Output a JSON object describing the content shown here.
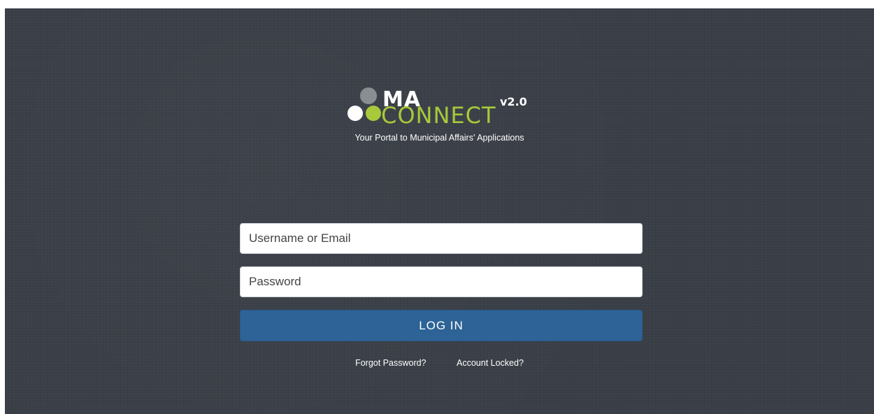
{
  "logo": {
    "brand_top": "MA",
    "brand_bottom": "CONNECT",
    "version": "v2.0",
    "colors": {
      "dot_gray": "#8a8d91",
      "dot_white": "#ffffff",
      "dot_green": "#a7c93a",
      "text_white": "#ffffff",
      "text_green": "#a7c93a"
    }
  },
  "tagline": "Your Portal to Municipal Affairs' Applications",
  "form": {
    "username_placeholder": "Username or Email",
    "password_placeholder": "Password",
    "login_label": "LOG IN"
  },
  "links": {
    "forgot_password": "Forgot Password?",
    "account_locked": "Account Locked?"
  },
  "colors": {
    "background": "#3a3f47",
    "button": "#2d6396"
  }
}
